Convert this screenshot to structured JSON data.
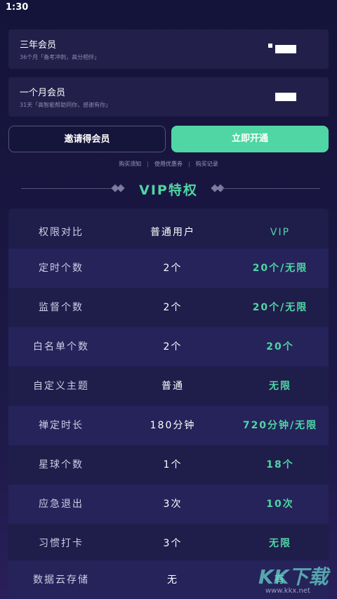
{
  "status_bar": {
    "time": "1:30"
  },
  "plans": [
    {
      "title": "三年会员",
      "desc": "36个月「备考冲刺，高分相伴」"
    },
    {
      "title": "一个月会员",
      "desc": "31天「高智能帮助同你，感谢有你」"
    }
  ],
  "buttons": {
    "invite": "邀请得会员",
    "open": "立即开通"
  },
  "links": [
    "购买须知",
    "使用优惠券",
    "购买记录"
  ],
  "vip_section": {
    "title": "VIP特权"
  },
  "table": {
    "header": {
      "name": "权限对比",
      "normal": "普通用户",
      "vip": "VIP"
    },
    "rows": [
      {
        "name": "定时个数",
        "normal": "2个",
        "vip": "20个/无限"
      },
      {
        "name": "监督个数",
        "normal": "2个",
        "vip": "20个/无限"
      },
      {
        "name": "白名单个数",
        "normal": "2个",
        "vip": "20个"
      },
      {
        "name": "自定义主题",
        "normal": "普通",
        "vip": "无限"
      },
      {
        "name": "禅定时长",
        "normal": "180分钟",
        "vip": "720分钟/无限"
      },
      {
        "name": "星球个数",
        "normal": "1个",
        "vip": "18个"
      },
      {
        "name": "应急退出",
        "normal": "3次",
        "vip": "10次"
      },
      {
        "name": "习惯打卡",
        "normal": "3个",
        "vip": "无限"
      },
      {
        "name": "数据云存储",
        "normal": "无",
        "vip": "有"
      }
    ]
  },
  "watermark": {
    "logo": "KK下载",
    "site": "www.kkx.net"
  },
  "colors": {
    "accent": "#4fd6a4",
    "background": "#1a1742",
    "card": "#22204a"
  }
}
